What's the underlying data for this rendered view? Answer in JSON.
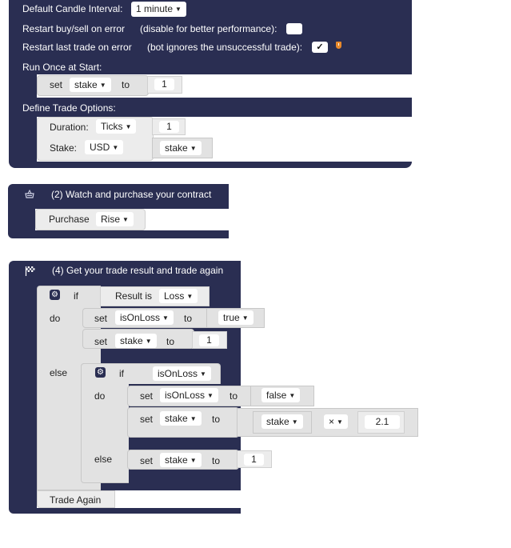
{
  "block1": {
    "candle_label": "Default Candle Interval:",
    "candle_value": "1 minute",
    "restart_buysell_label": "Restart buy/sell on error",
    "restart_buysell_hint": "(disable for better performance):",
    "restart_buysell_checked": false,
    "restart_last_label": "Restart last trade on error",
    "restart_last_hint": "(bot ignores the unsuccessful trade):",
    "restart_last_checked": true,
    "restart_last_check_glyph": "✓",
    "warning_icon": "shield-warning-icon",
    "run_once_label": "Run Once at Start:",
    "run_once": {
      "set": "set",
      "var": "stake",
      "to": "to",
      "value": "1"
    },
    "trade_options_label": "Define Trade Options:",
    "duration_label": "Duration:",
    "duration_unit": "Ticks",
    "duration_value": "1",
    "stake_label": "Stake:",
    "stake_currency": "USD",
    "stake_var": "stake"
  },
  "block2": {
    "icon": "basket-icon",
    "title": "(2) Watch and purchase your contract",
    "purchase_label": "Purchase",
    "purchase_value": "Rise"
  },
  "block4": {
    "icon": "checkered-flag-icon",
    "title": "(4) Get your trade result and trade again",
    "if_label": "if",
    "result_is": "Result is",
    "result_value": "Loss",
    "do_label": "do",
    "do_set1": {
      "set": "set",
      "var": "isOnLoss",
      "to": "to",
      "value": "true"
    },
    "do_set2": {
      "set": "set",
      "var": "stake",
      "to": "to",
      "value": "1"
    },
    "else_label": "else",
    "inner_if_label": "if",
    "inner_cond": "isOnLoss",
    "inner_do_label": "do",
    "inner_set1": {
      "set": "set",
      "var": "isOnLoss",
      "to": "to",
      "value": "false"
    },
    "inner_set2": {
      "set": "set",
      "var": "stake",
      "to": "to",
      "operand_var": "stake",
      "operator": "×",
      "operand_value": "2.1"
    },
    "inner_else_label": "else",
    "inner_else_set": {
      "set": "set",
      "var": "stake",
      "to": "to",
      "value": "1"
    },
    "trade_again": "Trade Again"
  }
}
